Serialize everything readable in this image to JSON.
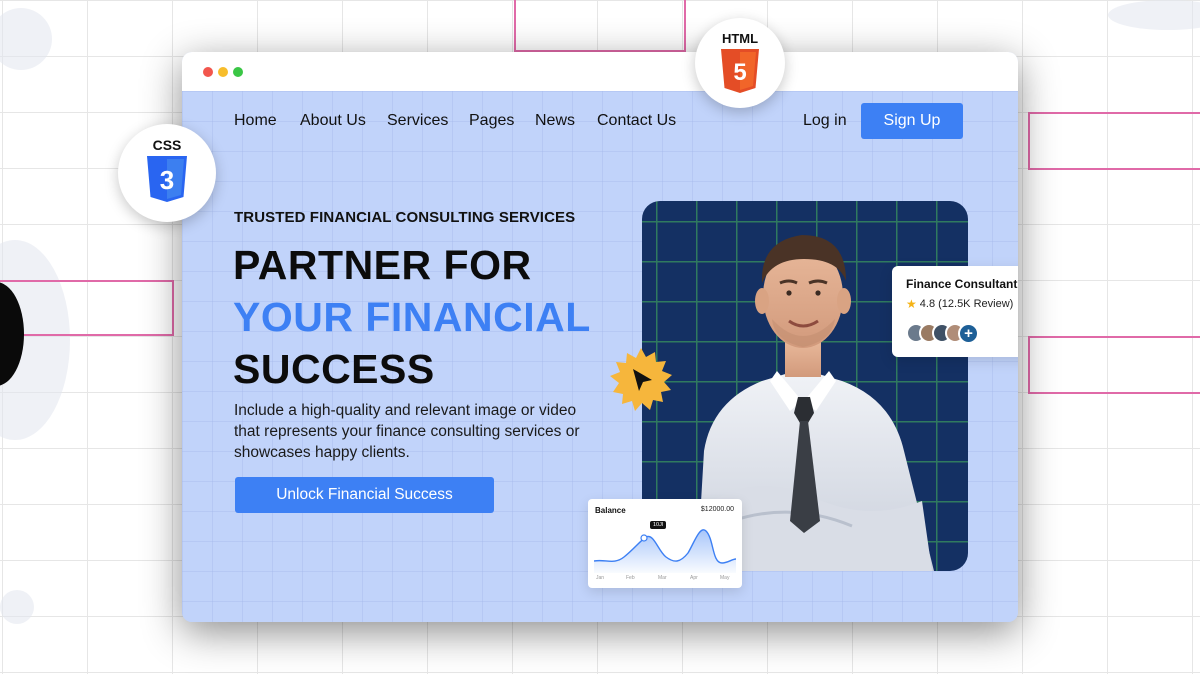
{
  "nav": {
    "items": [
      {
        "label": "Home"
      },
      {
        "label": "About Us"
      },
      {
        "label": "Services"
      },
      {
        "label": "Pages"
      },
      {
        "label": "News"
      },
      {
        "label": "Contact Us"
      }
    ],
    "login_label": "Log in",
    "signup_label": "Sign Up"
  },
  "hero": {
    "eyebrow": "TRUSTED FINANCIAL CONSULTING SERVICES",
    "headline_line1": "PARTNER FOR",
    "headline_line2": "YOUR FINANCIAL",
    "headline_line3": "SUCCESS",
    "description": "Include a high-quality and relevant image or video that represents your finance consulting services or showcases happy clients.",
    "cta_label": "Unlock Financial Success"
  },
  "consultant_card": {
    "title": "Finance Consultant",
    "rating": "4.8 (12.5K Review)",
    "plus_label": "+"
  },
  "balance_card": {
    "title": "Balance",
    "amount": "$12000.00",
    "tooltip": "10Jl",
    "months": [
      "Jan",
      "Feb",
      "Mar",
      "Apr",
      "May"
    ]
  },
  "badges": {
    "html_label": "HTML",
    "html_number": "5",
    "css_label": "CSS",
    "css_number": "3"
  },
  "colors": {
    "accent": "#3d80f4",
    "hero_bg": "#c1d3fa",
    "photo_bg": "#143063",
    "html_orange": "#e44d26",
    "css_blue": "#2965f1",
    "badge_yellow": "#f6b63c"
  },
  "icons": {
    "window_controls": [
      "close-dot",
      "minimize-dot",
      "maximize-dot"
    ],
    "cursor_badge": "cursor-arrow-icon",
    "rating": "star-icon"
  }
}
